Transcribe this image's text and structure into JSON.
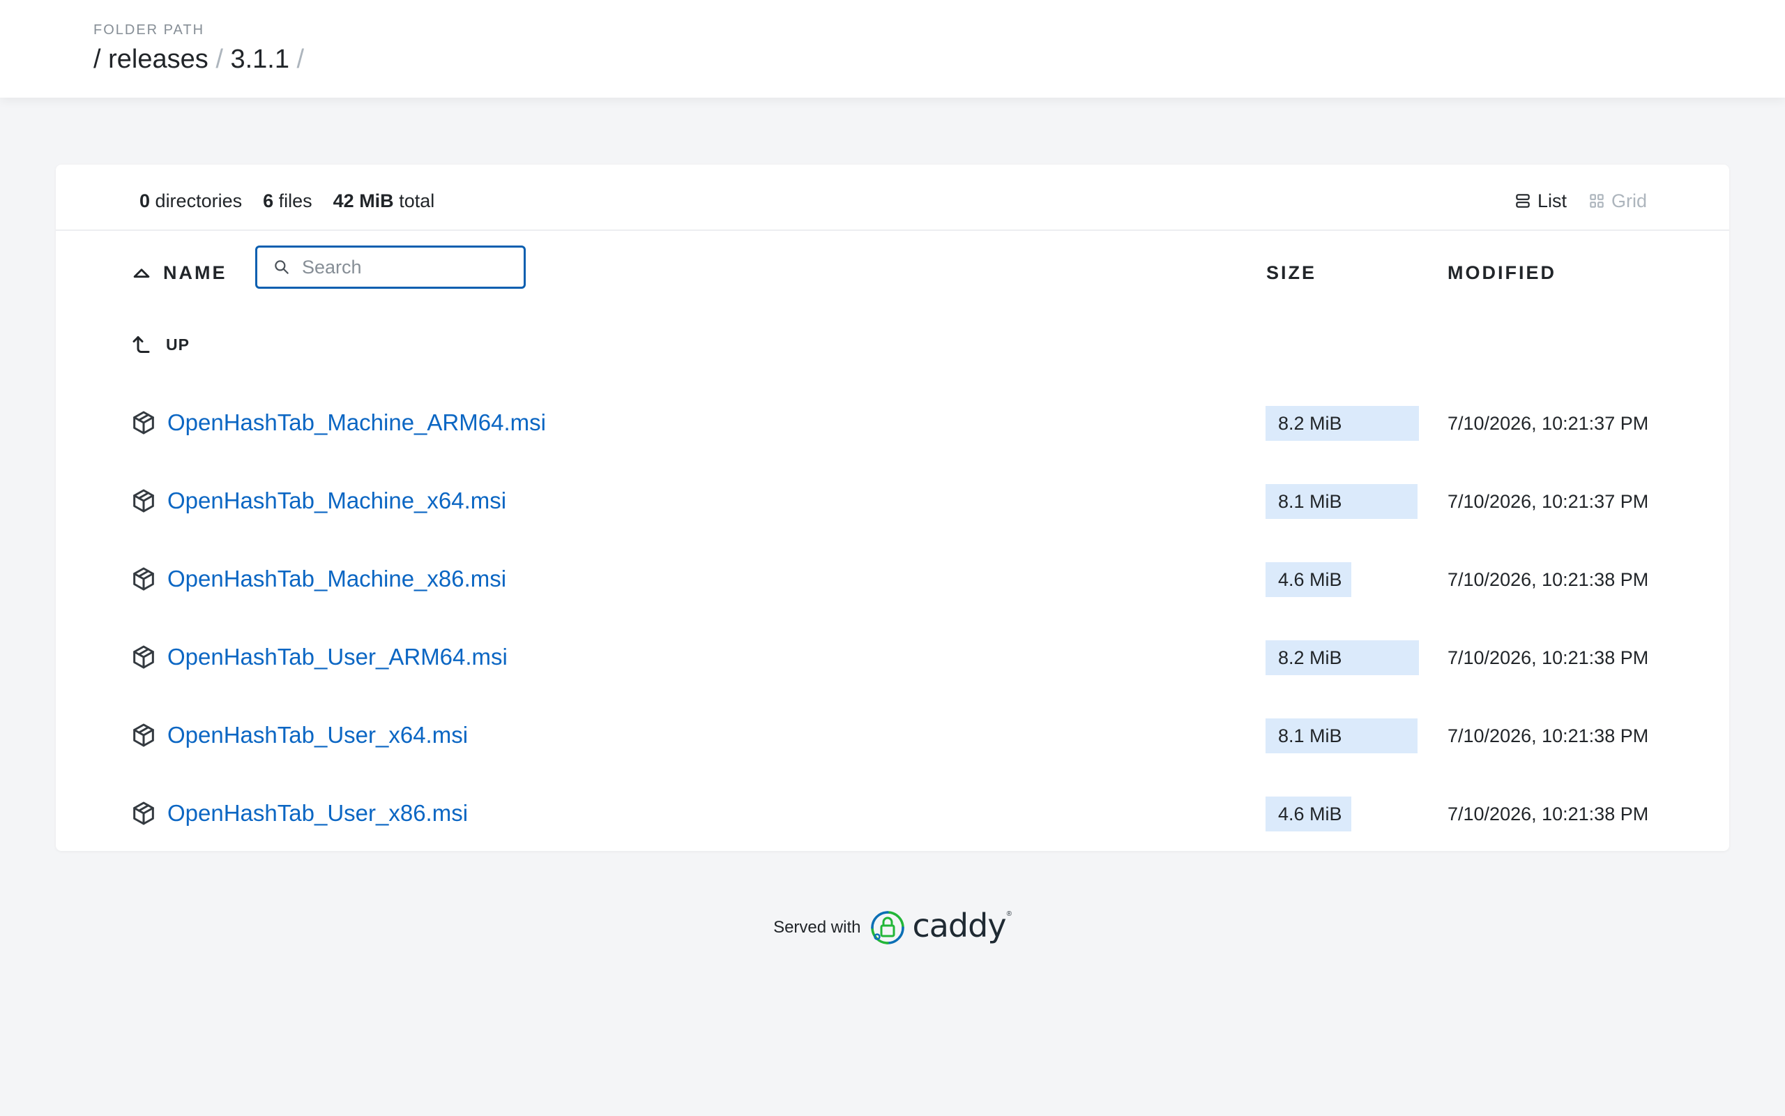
{
  "header": {
    "folder_label": "Folder Path",
    "breadcrumb": [
      {
        "sep": "/",
        "name": "releases"
      },
      {
        "sep": "/",
        "name": "3.1.1"
      }
    ],
    "trailing_sep": "/"
  },
  "summary": {
    "directories_count": "0",
    "directories_label": "directories",
    "files_count": "6",
    "files_label": "files",
    "total_size": "42 MiB",
    "total_label": "total"
  },
  "view_toggle": {
    "list_label": "List",
    "grid_label": "Grid",
    "active": "list"
  },
  "columns": {
    "name": "NAME",
    "size": "SIZE",
    "modified": "MODIFIED",
    "sort_direction": "ascending"
  },
  "search": {
    "placeholder": "Search",
    "value": ""
  },
  "up_label": "UP",
  "files": [
    {
      "name": "OpenHashTab_Machine_ARM64.msi",
      "size": "8.2 MiB",
      "size_fraction": 1.0,
      "modified": "7/10/2026, 10:21:37 PM",
      "icon": "package-icon"
    },
    {
      "name": "OpenHashTab_Machine_x64.msi",
      "size": "8.1 MiB",
      "size_fraction": 0.99,
      "modified": "7/10/2026, 10:21:37 PM",
      "icon": "package-icon"
    },
    {
      "name": "OpenHashTab_Machine_x86.msi",
      "size": "4.6 MiB",
      "size_fraction": 0.56,
      "modified": "7/10/2026, 10:21:38 PM",
      "icon": "package-icon"
    },
    {
      "name": "OpenHashTab_User_ARM64.msi",
      "size": "8.2 MiB",
      "size_fraction": 1.0,
      "modified": "7/10/2026, 10:21:38 PM",
      "icon": "package-icon"
    },
    {
      "name": "OpenHashTab_User_x64.msi",
      "size": "8.1 MiB",
      "size_fraction": 0.99,
      "modified": "7/10/2026, 10:21:38 PM",
      "icon": "package-icon"
    },
    {
      "name": "OpenHashTab_User_x86.msi",
      "size": "4.6 MiB",
      "size_fraction": 0.56,
      "modified": "7/10/2026, 10:21:38 PM",
      "icon": "package-icon"
    }
  ],
  "footer": {
    "served_with": "Served with",
    "brand": "caddy",
    "brand_colors": {
      "green": "#22b638",
      "blue": "#0b6fb5"
    }
  },
  "colors": {
    "link": "#0b66c3",
    "size_bar": "#dbeafb",
    "search_border": "#0b5fb0",
    "background": "#f4f5f7"
  }
}
